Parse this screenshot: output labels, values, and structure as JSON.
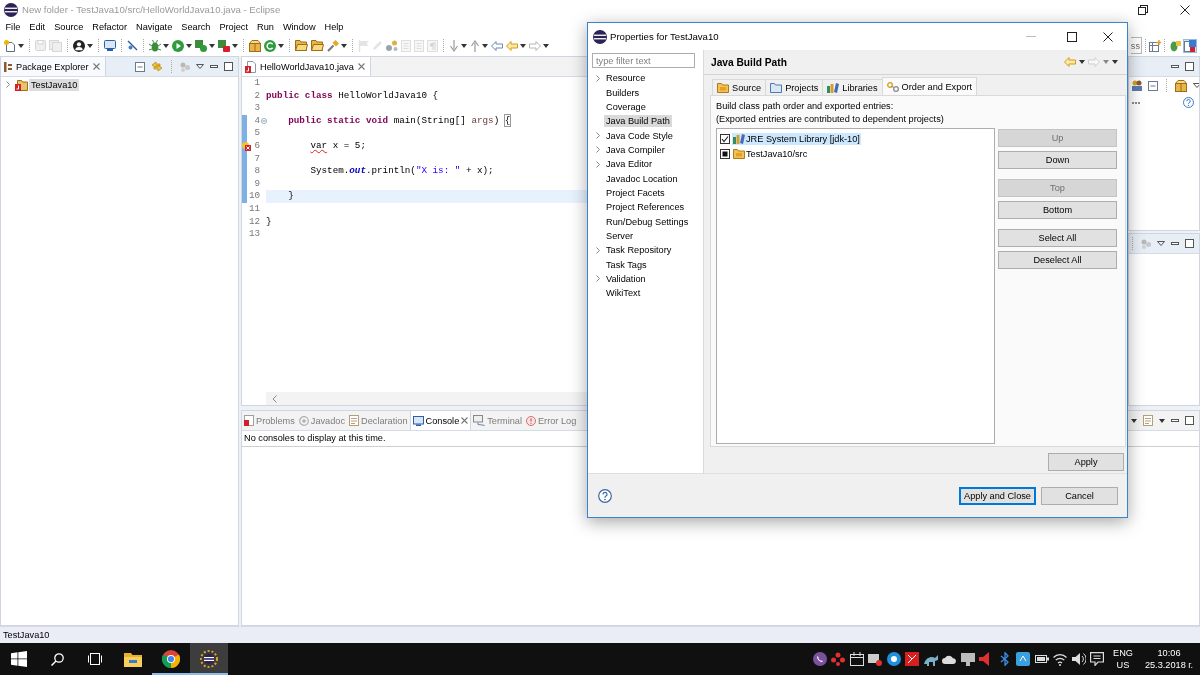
{
  "window": {
    "title": "New folder - TestJava10/src/HelloWorldJava10.java - Eclipse"
  },
  "menu": [
    "File",
    "Edit",
    "Source",
    "Refactor",
    "Navigate",
    "Search",
    "Project",
    "Run",
    "Window",
    "Help"
  ],
  "toolbar_field": {
    "placeholder": "ss"
  },
  "perspectives": [
    {
      "kind": "debug",
      "selected": false
    },
    {
      "kind": "java",
      "selected": true
    }
  ],
  "package_explorer": {
    "title": "Package Explorer",
    "items": [
      {
        "label": "TestJava10",
        "expanded": false,
        "selected": true
      }
    ]
  },
  "editor": {
    "tab": "HelloWorldJava10.java",
    "lines": [
      {
        "number": "1",
        "current": false,
        "changed": false,
        "error": false,
        "collapsible": false
      },
      {
        "number": "2",
        "current": false,
        "changed": false,
        "error": false,
        "collapsible": false,
        "tokens": [
          {
            "text": "public class",
            "kind": "keyword"
          },
          {
            "text": " HelloWorldJava10 {",
            "kind": "plain"
          }
        ]
      },
      {
        "number": "3",
        "current": false,
        "changed": false,
        "error": false,
        "collapsible": false
      },
      {
        "number": "4",
        "current": false,
        "changed": true,
        "error": false,
        "collapsible": true,
        "tokens": [
          {
            "text": "    public static void",
            "kind": "keyword"
          },
          {
            "text": " main(String[] ",
            "kind": "plain"
          },
          {
            "text": "args",
            "kind": "param"
          },
          {
            "text": ") ",
            "kind": "plain"
          },
          {
            "text": "{",
            "kind": "bracket"
          }
        ]
      },
      {
        "number": "5",
        "current": false,
        "changed": true,
        "error": false,
        "collapsible": false
      },
      {
        "number": "6",
        "current": false,
        "changed": true,
        "error": true,
        "collapsible": false,
        "tokens": [
          {
            "text": "        var",
            "kind": "error"
          },
          {
            "text": " x = 5;",
            "kind": "plain"
          }
        ]
      },
      {
        "number": "7",
        "current": false,
        "changed": true,
        "error": false,
        "collapsible": false
      },
      {
        "number": "8",
        "current": false,
        "changed": true,
        "error": false,
        "collapsible": false,
        "tokens": [
          {
            "text": "        System.",
            "kind": "plain"
          },
          {
            "text": "out",
            "kind": "field"
          },
          {
            "text": ".println(",
            "kind": "plain"
          },
          {
            "text": "\"X is: \"",
            "kind": "string"
          },
          {
            "text": " + x);",
            "kind": "plain"
          }
        ]
      },
      {
        "number": "9",
        "current": false,
        "changed": true,
        "error": false,
        "collapsible": false
      },
      {
        "number": "10",
        "current": true,
        "changed": true,
        "error": false,
        "collapsible": false,
        "tokens": [
          {
            "text": "    }",
            "kind": "plain"
          }
        ]
      },
      {
        "number": "11",
        "current": false,
        "changed": false,
        "error": false,
        "collapsible": false
      },
      {
        "number": "12",
        "current": false,
        "changed": false,
        "error": false,
        "collapsible": false,
        "tokens": [
          {
            "text": "}",
            "kind": "plain"
          }
        ]
      },
      {
        "number": "13",
        "current": false,
        "changed": false,
        "error": false,
        "collapsible": false
      }
    ]
  },
  "bottom_panel": {
    "tabs": [
      {
        "label": "Problems",
        "kind": "problems",
        "selected": false
      },
      {
        "label": "Javadoc",
        "kind": "javadoc",
        "selected": false
      },
      {
        "label": "Declaration",
        "kind": "declaration",
        "selected": false
      },
      {
        "label": "Console",
        "kind": "console",
        "selected": true
      },
      {
        "label": "Terminal",
        "kind": "terminal",
        "selected": false
      },
      {
        "label": "Error Log",
        "kind": "errorlog",
        "selected": false
      }
    ],
    "message": "No consoles to display at this time."
  },
  "status_bar": {
    "text": "TestJava10"
  },
  "dialog": {
    "title": "Properties for TestJava10",
    "filter": {
      "placeholder": "type filter text"
    },
    "tree": [
      {
        "label": "Resource",
        "expandable": true,
        "selected": false
      },
      {
        "label": "Builders",
        "expandable": false,
        "selected": false
      },
      {
        "label": "Coverage",
        "expandable": false,
        "selected": false
      },
      {
        "label": "Java Build Path",
        "expandable": false,
        "selected": true
      },
      {
        "label": "Java Code Style",
        "expandable": true,
        "selected": false
      },
      {
        "label": "Java Compiler",
        "expandable": true,
        "selected": false
      },
      {
        "label": "Java Editor",
        "expandable": true,
        "selected": false
      },
      {
        "label": "Javadoc Location",
        "expandable": false,
        "selected": false
      },
      {
        "label": "Project Facets",
        "expandable": false,
        "selected": false
      },
      {
        "label": "Project References",
        "expandable": false,
        "selected": false
      },
      {
        "label": "Run/Debug Settings",
        "expandable": false,
        "selected": false
      },
      {
        "label": "Server",
        "expandable": false,
        "selected": false
      },
      {
        "label": "Task Repository",
        "expandable": true,
        "selected": false
      },
      {
        "label": "Task Tags",
        "expandable": false,
        "selected": false
      },
      {
        "label": "Validation",
        "expandable": true,
        "selected": false
      },
      {
        "label": "WikiText",
        "expandable": false,
        "selected": false
      }
    ],
    "page": {
      "title": "Java Build Path",
      "tabs": [
        {
          "label": "Source",
          "kind": "source",
          "selected": false
        },
        {
          "label": "Projects",
          "kind": "projects",
          "selected": false
        },
        {
          "label": "Libraries",
          "kind": "libraries",
          "selected": false
        },
        {
          "label": "Order and Export",
          "kind": "order",
          "selected": true
        }
      ],
      "description": [
        "Build class path order and exported entries:",
        "(Exported entries are contributed to dependent projects)"
      ],
      "entries": [
        {
          "label": "JRE System Library [jdk-10]",
          "kind": "library",
          "checked": true,
          "grayed": false,
          "selected": true
        },
        {
          "label": "TestJava10/src",
          "kind": "source",
          "checked": true,
          "grayed": true,
          "selected": false
        }
      ],
      "button_groups": [
        {
          "buttons": [
            {
              "label": "Up",
              "disabled": true
            },
            {
              "label": "Down",
              "disabled": false
            }
          ]
        },
        {
          "buttons": [
            {
              "label": "Top",
              "disabled": true
            },
            {
              "label": "Bottom",
              "disabled": false
            }
          ]
        },
        {
          "buttons": [
            {
              "label": "Select All",
              "disabled": false
            },
            {
              "label": "Deselect All",
              "disabled": false
            }
          ]
        }
      ],
      "apply": "Apply"
    },
    "buttons": [
      {
        "label": "Apply and Close",
        "default": true
      },
      {
        "label": "Cancel",
        "default": false
      }
    ]
  },
  "taskbar": {
    "apps": [
      {
        "kind": "start",
        "running": false,
        "active": false
      },
      {
        "kind": "search",
        "running": false,
        "active": false
      },
      {
        "kind": "task_view",
        "running": false,
        "active": false
      },
      {
        "kind": "files",
        "running": false,
        "active": false
      },
      {
        "kind": "browser",
        "running": true,
        "active": false
      },
      {
        "kind": "eclipse",
        "running": true,
        "active": true
      }
    ],
    "language": "ENG",
    "region": "US",
    "time": "10:06",
    "date": "25.3.2018 г."
  }
}
